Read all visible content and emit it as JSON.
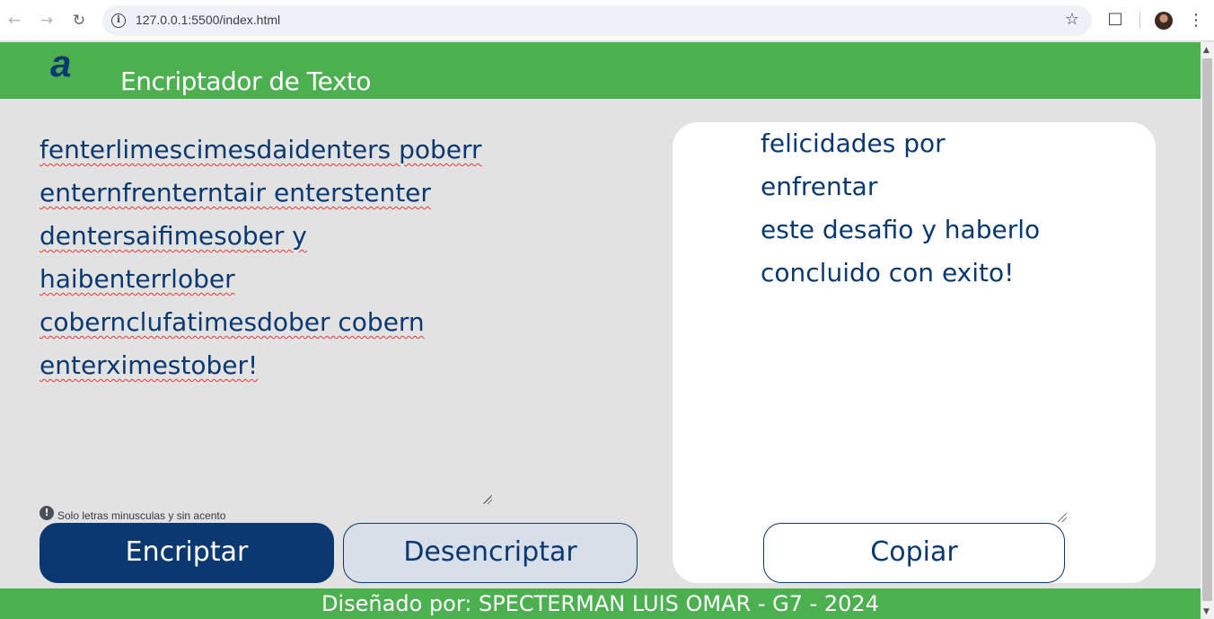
{
  "browser": {
    "url": "127.0.0.1:5500/index.html"
  },
  "header": {
    "logo_text": "a",
    "title": "Encriptador de Texto"
  },
  "input": {
    "text": "fenterlimescimesdaidenters poberr\nenternfrenterntair enterstenter\ndentersaifimesober y\nhaibenterrlober\ncobernclufatimesdober cobern\nenterximestober!",
    "hint": "Solo letras minusculas y sin acento"
  },
  "buttons": {
    "encrypt": "Encriptar",
    "decrypt": "Desencriptar",
    "copy": "Copiar"
  },
  "output": {
    "text": "felicidades por enfrentar\neste desafio y haberlo\nconcluido con exito!"
  },
  "footer": {
    "text": "Diseñado por: SPECTERMAN LUIS OMAR - G7 - 2024"
  },
  "colors": {
    "header_bg": "#4caf50",
    "primary": "#0a3871",
    "page_bg": "#e2e2e2"
  }
}
